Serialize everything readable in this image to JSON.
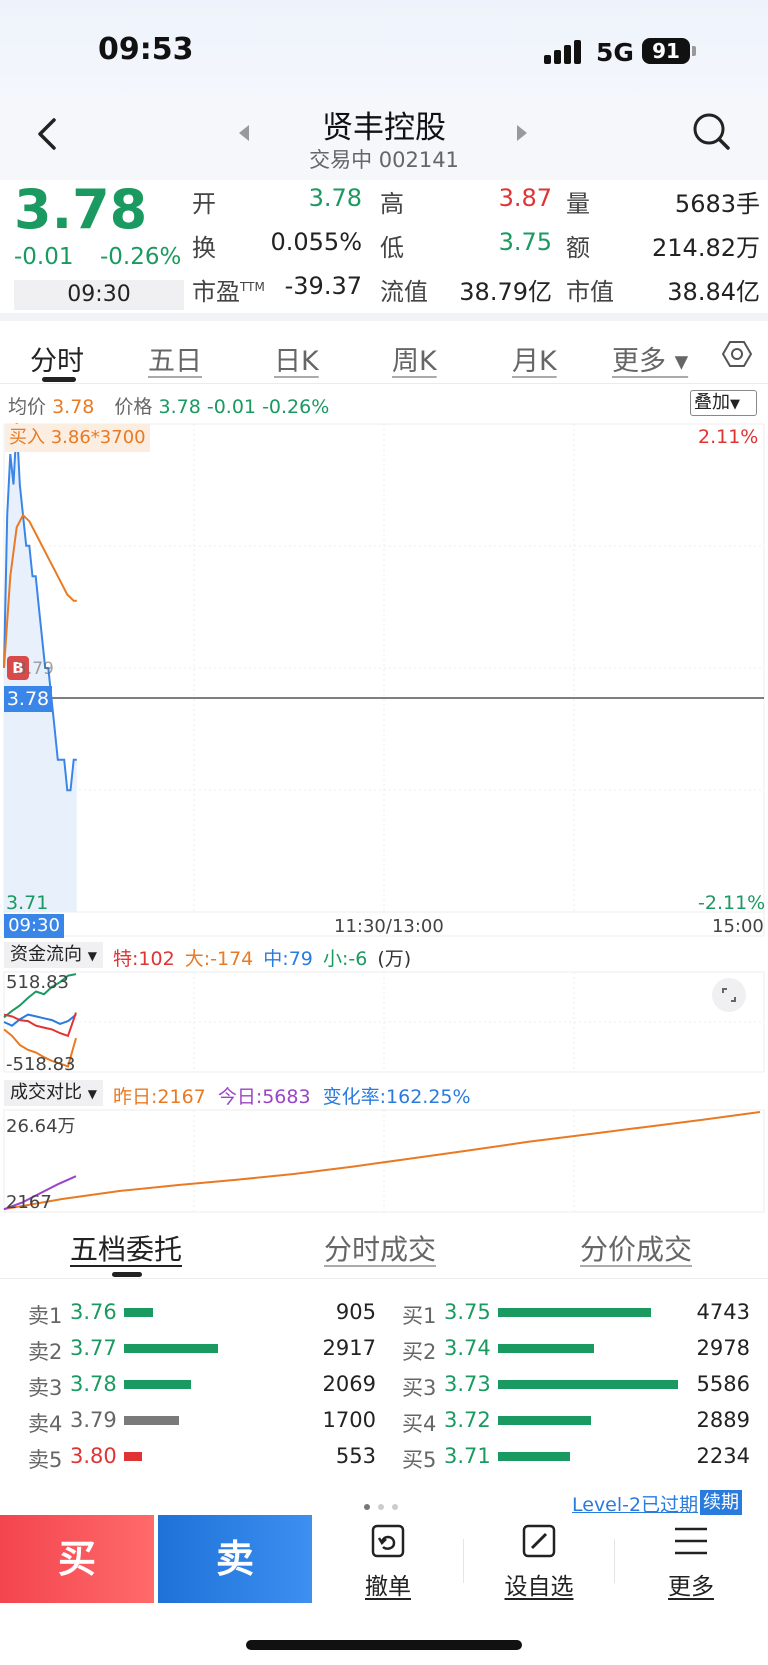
{
  "status": {
    "time": "09:53",
    "network": "5G",
    "battery": "91"
  },
  "header": {
    "title": "贤丰控股",
    "subtitle": "交易中 002141",
    "back_icon": "chevron-left-icon",
    "search_icon": "search-icon"
  },
  "quote": {
    "price": "3.78",
    "change": "-0.01",
    "change_pct": "-0.26%",
    "time": "09:30",
    "fields": [
      {
        "label": "开",
        "value": "3.78",
        "color": "#1a9960"
      },
      {
        "label": "高",
        "value": "3.87",
        "color": "#e03333"
      },
      {
        "label": "量",
        "value": "5683手",
        "color": "#222222"
      },
      {
        "label": "换",
        "value": "0.055%",
        "color": "#222222"
      },
      {
        "label": "低",
        "value": "3.75",
        "color": "#1a9960"
      },
      {
        "label": "额",
        "value": "214.82万",
        "color": "#222222"
      },
      {
        "label": "市盈",
        "label_sup": "TTM",
        "value": "-39.37",
        "color": "#222222"
      },
      {
        "label": "流值",
        "value": "38.79亿",
        "color": "#222222"
      },
      {
        "label": "市值",
        "value": "38.84亿",
        "color": "#222222"
      }
    ]
  },
  "tabs": [
    "分时",
    "五日",
    "日K",
    "周K",
    "月K",
    "更多 ▾"
  ],
  "chart_legend": {
    "avg_label": "均价",
    "avg_value": "3.78",
    "price_label": "价格",
    "price_value": "3.78",
    "price_change": "-0.01",
    "price_pct": "-0.26%",
    "overlay": "叠加"
  },
  "chart_labels": {
    "buy_tag": "买入 3.86*3700",
    "top_pct": "2.11%",
    "bottom_pct": "-2.11%",
    "price_tag": "3.78",
    "small_tag": "3.79",
    "low_price": "3.71",
    "time_start": "09:30",
    "time_mid": "11:30/13:00",
    "time_end": "15:00"
  },
  "chart_data": [
    {
      "type": "line",
      "title": "分时",
      "y_range": [
        3.7102,
        3.8698
      ],
      "prev_close": 3.79,
      "series": [
        {
          "name": "价格",
          "color": "#3a86e8",
          "x": [
            0,
            1,
            2,
            3,
            4,
            5,
            6,
            7,
            8,
            9,
            10,
            11,
            12,
            13,
            14,
            15,
            16,
            17,
            18,
            19,
            20,
            21,
            22,
            23
          ],
          "values": [
            3.79,
            3.84,
            3.86,
            3.85,
            3.87,
            3.85,
            3.84,
            3.83,
            3.83,
            3.82,
            3.82,
            3.81,
            3.8,
            3.79,
            3.79,
            3.78,
            3.77,
            3.76,
            3.76,
            3.76,
            3.75,
            3.75,
            3.76,
            3.76
          ]
        },
        {
          "name": "均价",
          "color": "#e97a23",
          "x": [
            0,
            2,
            4,
            6,
            8,
            10,
            12,
            14,
            16,
            18,
            20,
            22,
            23
          ],
          "values": [
            3.79,
            3.82,
            3.836,
            3.84,
            3.838,
            3.834,
            3.83,
            3.826,
            3.822,
            3.818,
            3.814,
            3.812,
            3.812
          ]
        }
      ]
    },
    {
      "type": "line",
      "title": "资金流向",
      "unit": "(万)",
      "legend": [
        {
          "label": "特:102",
          "color": "#e03333"
        },
        {
          "label": "大:-174",
          "color": "#e97a23"
        },
        {
          "label": "中:79",
          "color": "#2a7bde"
        },
        {
          "label": "小:-6",
          "color": "#1a9960"
        }
      ],
      "ylim": [
        -518.83,
        518.83
      ],
      "y_labels": [
        "518.83",
        "-518.83"
      ],
      "series": [
        {
          "color": "#1a9960",
          "values": [
            50,
            120,
            180,
            260,
            330,
            300,
            380,
            430,
            500,
            518
          ]
        },
        {
          "color": "#2a7bde",
          "values": [
            0,
            -40,
            30,
            80,
            60,
            40,
            20,
            -20,
            10,
            79
          ]
        },
        {
          "color": "#e03333",
          "values": [
            80,
            60,
            20,
            10,
            -40,
            -60,
            -80,
            -120,
            -150,
            102
          ]
        },
        {
          "color": "#e97a23",
          "values": [
            -80,
            -150,
            -250,
            -300,
            -330,
            -380,
            -420,
            -450,
            -480,
            -174
          ]
        }
      ]
    },
    {
      "type": "line",
      "title": "成交对比",
      "legend": [
        {
          "label": "昨日:2167",
          "color": "#e97a23"
        },
        {
          "label": "今日:5683",
          "color": "#9a45c6"
        },
        {
          "label": "变化率:162.25%",
          "color": "#2a7bde"
        }
      ],
      "y_labels": [
        "26.64万",
        "2167"
      ],
      "series": [
        {
          "name": "昨日",
          "color": "#e97a23",
          "values": [
            2167,
            30000,
            52000,
            68000,
            82000,
            98000,
            118000,
            140000,
            162000,
            185000,
            205000,
            225000,
            245000,
            266400
          ]
        },
        {
          "name": "今日",
          "color": "#9a45c6",
          "values": [
            2167,
            20000,
            45000,
            70000,
            92000
          ]
        }
      ]
    }
  ],
  "book_tabs": [
    "五档委托",
    "分时成交",
    "分价成交"
  ],
  "asks": [
    {
      "label": "卖1",
      "price": "3.76",
      "qty": "905",
      "qty_num": 905,
      "color": "#1a9960"
    },
    {
      "label": "卖2",
      "price": "3.77",
      "qty": "2917",
      "qty_num": 2917,
      "color": "#1a9960"
    },
    {
      "label": "卖3",
      "price": "3.78",
      "qty": "2069",
      "qty_num": 2069,
      "color": "#1a9960"
    },
    {
      "label": "卖4",
      "price": "3.79",
      "qty": "1700",
      "qty_num": 1700,
      "color": "#7a7a7a"
    },
    {
      "label": "卖5",
      "price": "3.80",
      "qty": "553",
      "qty_num": 553,
      "color": "#e03333"
    }
  ],
  "bids": [
    {
      "label": "买1",
      "price": "3.75",
      "qty": "4743",
      "qty_num": 4743,
      "color": "#1a9960"
    },
    {
      "label": "买2",
      "price": "3.74",
      "qty": "2978",
      "qty_num": 2978,
      "color": "#1a9960"
    },
    {
      "label": "买3",
      "price": "3.73",
      "qty": "5586",
      "qty_num": 5586,
      "color": "#1a9960"
    },
    {
      "label": "买4",
      "price": "3.72",
      "qty": "2889",
      "qty_num": 2889,
      "color": "#1a9960"
    },
    {
      "label": "买5",
      "price": "3.71",
      "qty": "2234",
      "qty_num": 2234,
      "color": "#1a9960"
    }
  ],
  "level2": {
    "text": "Level-2已过期",
    "renew": "续期"
  },
  "bottom": {
    "buy": "买",
    "sell": "卖",
    "cancel": "撤单",
    "watch": "设自选",
    "more": "更多"
  }
}
